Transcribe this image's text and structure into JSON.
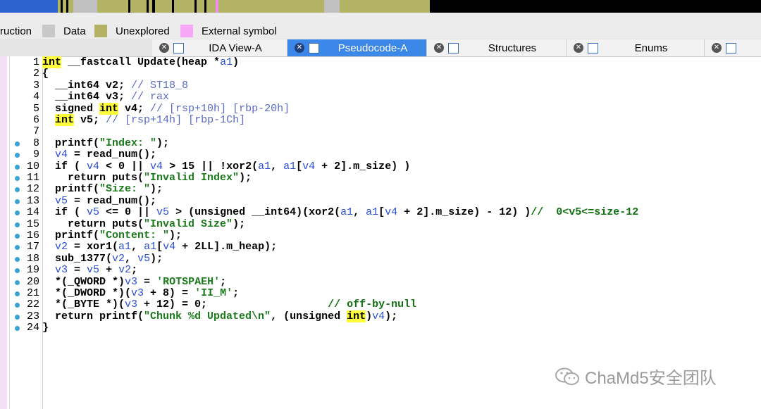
{
  "nav_band": {
    "colors": {
      "bg": "#000000",
      "olive": "#b2b365",
      "grey": "#c0c0c0",
      "blue": "#2e62d0",
      "pink": "#f28ef2"
    }
  },
  "legend": {
    "items": [
      {
        "label": "ruction",
        "color": ""
      },
      {
        "label": "Data",
        "color": "#c8c8c8"
      },
      {
        "label": "Unexplored",
        "color": "#b3b267"
      },
      {
        "label": "External symbol",
        "color": "#f6a8f6"
      }
    ]
  },
  "tabs": [
    {
      "label": "IDA View-A",
      "icon": "ida-view-icon",
      "active": false
    },
    {
      "label": "Pseudocode-A",
      "icon": "pseudocode-icon",
      "active": true
    },
    {
      "label": "Structures",
      "icon": "structures-icon",
      "active": false
    },
    {
      "label": "Enums",
      "icon": "enums-icon",
      "active": false
    }
  ],
  "code": [
    {
      "n": "1",
      "dot": false,
      "parts": [
        [
          "hl",
          "int"
        ],
        [
          "kw",
          " __fastcall Update(heap *"
        ],
        [
          "var",
          "a1"
        ],
        [
          "kw",
          ")"
        ]
      ]
    },
    {
      "n": "2",
      "dot": false,
      "parts": [
        [
          "kw",
          "{"
        ]
      ]
    },
    {
      "n": "3",
      "dot": false,
      "parts": [
        [
          "kw",
          "  __int64 v2; "
        ],
        [
          "cm",
          "// ST18_8"
        ]
      ]
    },
    {
      "n": "4",
      "dot": false,
      "parts": [
        [
          "kw",
          "  __int64 v3; "
        ],
        [
          "cm",
          "// rax"
        ]
      ]
    },
    {
      "n": "5",
      "dot": false,
      "parts": [
        [
          "kw",
          "  signed "
        ],
        [
          "hl",
          "int"
        ],
        [
          "kw",
          " v4; "
        ],
        [
          "cm",
          "// [rsp+10h] [rbp-20h]"
        ]
      ]
    },
    {
      "n": "6",
      "dot": false,
      "parts": [
        [
          "kw",
          "  "
        ],
        [
          "hl",
          "int"
        ],
        [
          "kw",
          " v5; "
        ],
        [
          "cm",
          "// [rsp+14h] [rbp-1Ch]"
        ]
      ]
    },
    {
      "n": "7",
      "dot": false,
      "parts": [
        [
          "kw",
          ""
        ]
      ]
    },
    {
      "n": "8",
      "dot": true,
      "parts": [
        [
          "kw",
          "  printf("
        ],
        [
          "str",
          "\"Index: \""
        ],
        [
          "kw",
          ");"
        ]
      ]
    },
    {
      "n": "9",
      "dot": true,
      "parts": [
        [
          "kw",
          "  "
        ],
        [
          "var",
          "v4"
        ],
        [
          "kw",
          " = read_num();"
        ]
      ]
    },
    {
      "n": "10",
      "dot": true,
      "parts": [
        [
          "kw",
          "  if ( "
        ],
        [
          "var",
          "v4"
        ],
        [
          "kw",
          " < 0 || "
        ],
        [
          "var",
          "v4"
        ],
        [
          "kw",
          " > 15 || !xor2("
        ],
        [
          "var",
          "a1"
        ],
        [
          "kw",
          ", "
        ],
        [
          "var",
          "a1"
        ],
        [
          "kw",
          "["
        ],
        [
          "var",
          "v4"
        ],
        [
          "kw",
          " + 2].m_size) )"
        ]
      ]
    },
    {
      "n": "11",
      "dot": true,
      "parts": [
        [
          "kw",
          "    return puts("
        ],
        [
          "str",
          "\"Invalid Index\""
        ],
        [
          "kw",
          ");"
        ]
      ]
    },
    {
      "n": "12",
      "dot": true,
      "parts": [
        [
          "kw",
          "  printf("
        ],
        [
          "str",
          "\"Size: \""
        ],
        [
          "kw",
          ");"
        ]
      ]
    },
    {
      "n": "13",
      "dot": true,
      "parts": [
        [
          "kw",
          "  "
        ],
        [
          "var",
          "v5"
        ],
        [
          "kw",
          " = read_num();"
        ]
      ]
    },
    {
      "n": "14",
      "dot": true,
      "parts": [
        [
          "kw",
          "  if ( "
        ],
        [
          "var",
          "v5"
        ],
        [
          "kw",
          " <= 0 || "
        ],
        [
          "var",
          "v5"
        ],
        [
          "kw",
          " > (unsigned __int64)(xor2("
        ],
        [
          "var",
          "a1"
        ],
        [
          "kw",
          ", "
        ],
        [
          "var",
          "a1"
        ],
        [
          "kw",
          "["
        ],
        [
          "var",
          "v4"
        ],
        [
          "kw",
          " + 2].m_size) - 12) )"
        ],
        [
          "grn",
          "//  0<v5<=size-12"
        ]
      ]
    },
    {
      "n": "15",
      "dot": true,
      "parts": [
        [
          "kw",
          "    return puts("
        ],
        [
          "str",
          "\"Invalid Size\""
        ],
        [
          "kw",
          ");"
        ]
      ]
    },
    {
      "n": "16",
      "dot": true,
      "parts": [
        [
          "kw",
          "  printf("
        ],
        [
          "str",
          "\"Content: \""
        ],
        [
          "kw",
          ");"
        ]
      ]
    },
    {
      "n": "17",
      "dot": true,
      "parts": [
        [
          "kw",
          "  "
        ],
        [
          "var",
          "v2"
        ],
        [
          "kw",
          " = xor1("
        ],
        [
          "var",
          "a1"
        ],
        [
          "kw",
          ", "
        ],
        [
          "var",
          "a1"
        ],
        [
          "kw",
          "["
        ],
        [
          "var",
          "v4"
        ],
        [
          "kw",
          " + 2LL].m_heap);"
        ]
      ]
    },
    {
      "n": "18",
      "dot": true,
      "parts": [
        [
          "kw",
          "  sub_1377("
        ],
        [
          "var",
          "v2"
        ],
        [
          "kw",
          ", "
        ],
        [
          "var",
          "v5"
        ],
        [
          "kw",
          ");"
        ]
      ]
    },
    {
      "n": "19",
      "dot": true,
      "parts": [
        [
          "kw",
          "  "
        ],
        [
          "var",
          "v3"
        ],
        [
          "kw",
          " = "
        ],
        [
          "var",
          "v5"
        ],
        [
          "kw",
          " + "
        ],
        [
          "var",
          "v2"
        ],
        [
          "kw",
          ";"
        ]
      ]
    },
    {
      "n": "20",
      "dot": true,
      "parts": [
        [
          "kw",
          "  *(_QWORD *)"
        ],
        [
          "var",
          "v3"
        ],
        [
          "kw",
          " = "
        ],
        [
          "str",
          "'ROTSPAEH'"
        ],
        [
          "kw",
          ";"
        ]
      ]
    },
    {
      "n": "21",
      "dot": true,
      "parts": [
        [
          "kw",
          "  *(_DWORD *)("
        ],
        [
          "var",
          "v3"
        ],
        [
          "kw",
          " + 8) = "
        ],
        [
          "str",
          "'II_M'"
        ],
        [
          "kw",
          ";"
        ]
      ]
    },
    {
      "n": "22",
      "dot": true,
      "parts": [
        [
          "kw",
          "  *(_BYTE *)("
        ],
        [
          "var",
          "v3"
        ],
        [
          "kw",
          " + 12) = 0;                   "
        ],
        [
          "grn",
          "// off-by-null"
        ]
      ]
    },
    {
      "n": "23",
      "dot": true,
      "parts": [
        [
          "kw",
          "  return printf("
        ],
        [
          "str",
          "\"Chunk %d Updated\\n\""
        ],
        [
          "kw",
          ", (unsigned "
        ],
        [
          "hl",
          "int"
        ],
        [
          "kw",
          ")"
        ],
        [
          "var",
          "v4"
        ],
        [
          "kw",
          ");"
        ]
      ]
    },
    {
      "n": "24",
      "dot": true,
      "parts": [
        [
          "kw",
          "}"
        ]
      ]
    }
  ],
  "watermark": {
    "text": "ChaMd5安全团队",
    "icon": "wechat-icon"
  }
}
